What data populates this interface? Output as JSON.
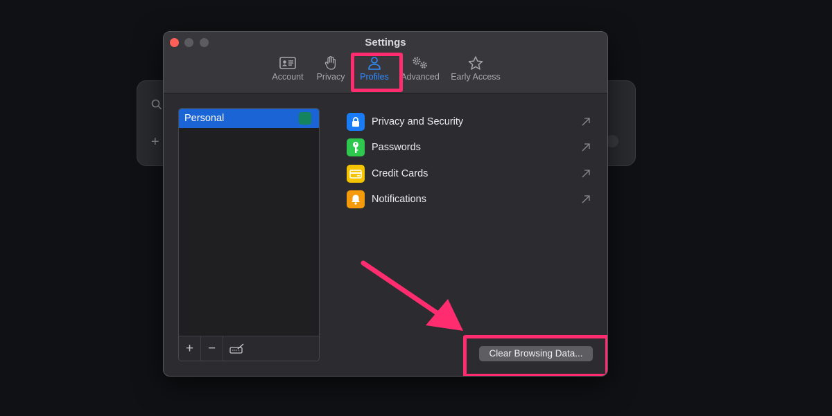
{
  "window": {
    "title": "Settings"
  },
  "tabs": [
    {
      "id": "account",
      "label": "Account",
      "icon": "id-card-icon"
    },
    {
      "id": "privacy",
      "label": "Privacy",
      "icon": "hand-icon"
    },
    {
      "id": "profiles",
      "label": "Profiles",
      "icon": "person-icon",
      "active": true
    },
    {
      "id": "advanced",
      "label": "Advanced",
      "icon": "gears-icon"
    },
    {
      "id": "early_access",
      "label": "Early Access",
      "icon": "star-icon"
    }
  ],
  "profiles": {
    "items": [
      {
        "name": "Personal",
        "color": "#13845e",
        "selected": true
      }
    ],
    "footer": {
      "add": "+",
      "remove": "−"
    }
  },
  "settings": [
    {
      "label": "Privacy and Security",
      "icon": "lock-icon",
      "color": "#1a7cf5"
    },
    {
      "label": "Passwords",
      "icon": "key-icon",
      "color": "#2fc84e"
    },
    {
      "label": "Credit Cards",
      "icon": "credit-card-icon",
      "color": "#f5c400"
    },
    {
      "label": "Notifications",
      "icon": "bell-icon",
      "color": "#f59a0b"
    }
  ],
  "actions": {
    "clear_browsing_data": "Clear Browsing Data..."
  },
  "colors": {
    "accent": "#2f8cff",
    "annotation": "#ff2d6f",
    "selection": "#1b64d6"
  }
}
